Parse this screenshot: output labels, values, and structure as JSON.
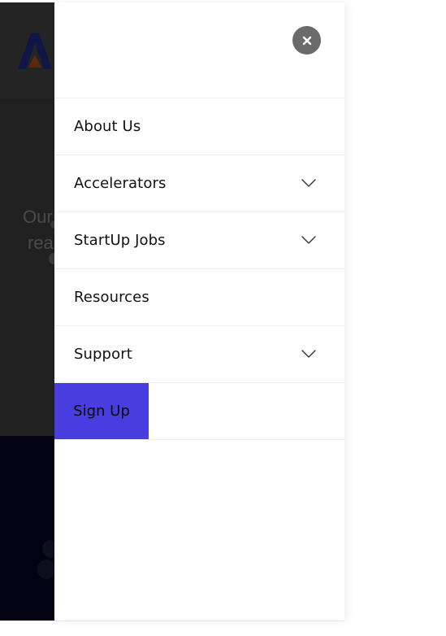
{
  "menu": {
    "close_icon": "close-icon",
    "items": [
      {
        "label": "About Us",
        "has_submenu": false
      },
      {
        "label": "Accelerators",
        "has_submenu": true
      },
      {
        "label": "StartUp Jobs",
        "has_submenu": true
      },
      {
        "label": "Resources",
        "has_submenu": false
      },
      {
        "label": "Support",
        "has_submenu": true
      }
    ],
    "signup_label": "Sign Up"
  },
  "background": {
    "hero_text_line1": "Our",
    "hero_text_line2": "rea"
  },
  "colors": {
    "accent": "#4a3ddf",
    "close_button": "#6b6b6b",
    "overlay": "#222222",
    "footer": "#030212"
  }
}
